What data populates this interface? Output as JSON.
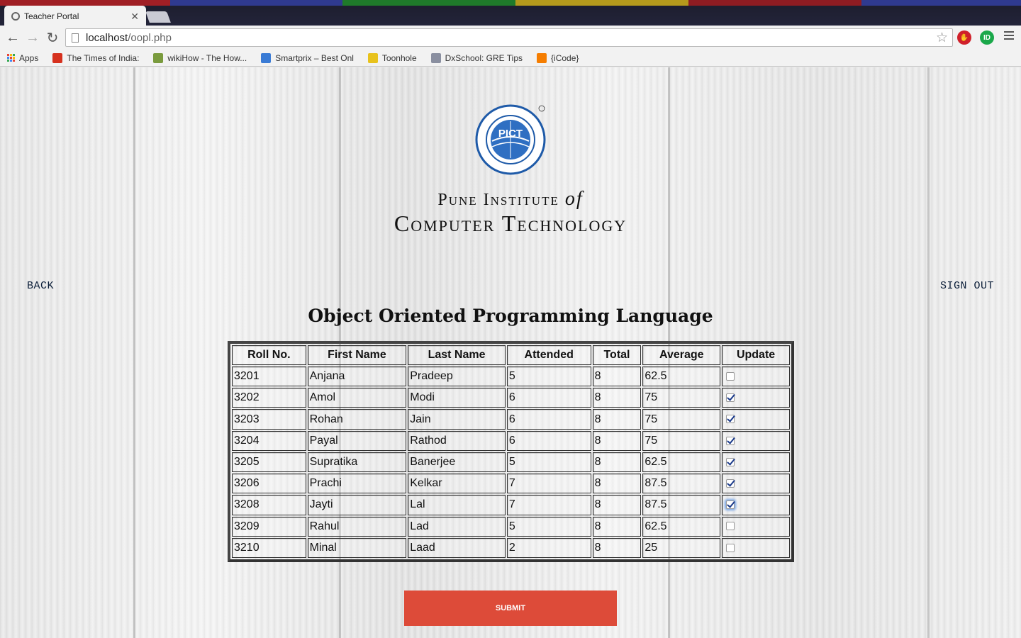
{
  "browser": {
    "tab_title": "Teacher Portal",
    "url_host": "localhost",
    "url_path": "/oopl.php",
    "bookmarks": [
      {
        "label": "Apps",
        "icon": "apps-icon",
        "color": "#4285f4"
      },
      {
        "label": "The Times of India:",
        "icon": "toi-icon",
        "color": "#d6311e"
      },
      {
        "label": "wikiHow - The How...",
        "icon": "wikihow-icon",
        "color": "#7a9b3e"
      },
      {
        "label": "Smartprix – Best Onl",
        "icon": "smartprix-icon",
        "color": "#3a7bd5"
      },
      {
        "label": "Toonhole",
        "icon": "toonhole-icon",
        "color": "#e8c21c"
      },
      {
        "label": "DxSchool: GRE Tips",
        "icon": "dxschool-icon",
        "color": "#8a8fa0"
      },
      {
        "label": "{iCode}",
        "icon": "blogger-icon",
        "color": "#f57d00"
      }
    ]
  },
  "header": {
    "logo_text": "PICT",
    "institute_line1": "Pune Institute",
    "institute_of": "of",
    "institute_line2": "Computer Technology"
  },
  "nav": {
    "back_label": "BACK",
    "signout_label": "SIGN OUT"
  },
  "course_title": "Object Oriented Programming Language",
  "table": {
    "headers": [
      "Roll No.",
      "First Name",
      "Last Name",
      "Attended",
      "Total",
      "Average",
      "Update"
    ],
    "rows": [
      {
        "roll": "3201",
        "first": "Anjana",
        "last": "Pradeep",
        "attended": "5",
        "total": "8",
        "average": "62.5",
        "update": false
      },
      {
        "roll": "3202",
        "first": "Amol",
        "last": "Modi",
        "attended": "6",
        "total": "8",
        "average": "75",
        "update": true
      },
      {
        "roll": "3203",
        "first": "Rohan",
        "last": "Jain",
        "attended": "6",
        "total": "8",
        "average": "75",
        "update": true
      },
      {
        "roll": "3204",
        "first": "Payal",
        "last": "Rathod",
        "attended": "6",
        "total": "8",
        "average": "75",
        "update": true
      },
      {
        "roll": "3205",
        "first": "Supratika",
        "last": "Banerjee",
        "attended": "5",
        "total": "8",
        "average": "62.5",
        "update": true
      },
      {
        "roll": "3206",
        "first": "Prachi",
        "last": "Kelkar",
        "attended": "7",
        "total": "8",
        "average": "87.5",
        "update": true
      },
      {
        "roll": "3208",
        "first": "Jayti",
        "last": "Lal",
        "attended": "7",
        "total": "8",
        "average": "87.5",
        "update": true
      },
      {
        "roll": "3209",
        "first": "Rahul",
        "last": "Lad",
        "attended": "5",
        "total": "8",
        "average": "62.5",
        "update": false
      },
      {
        "roll": "3210",
        "first": "Minal",
        "last": "Laad",
        "attended": "2",
        "total": "8",
        "average": "25",
        "update": false
      }
    ]
  },
  "submit_label": "SUBMIT",
  "colors": {
    "submit_bg": "#dd4b39",
    "link_color": "#0c1f3a",
    "logo_blue": "#1e5aa8"
  }
}
